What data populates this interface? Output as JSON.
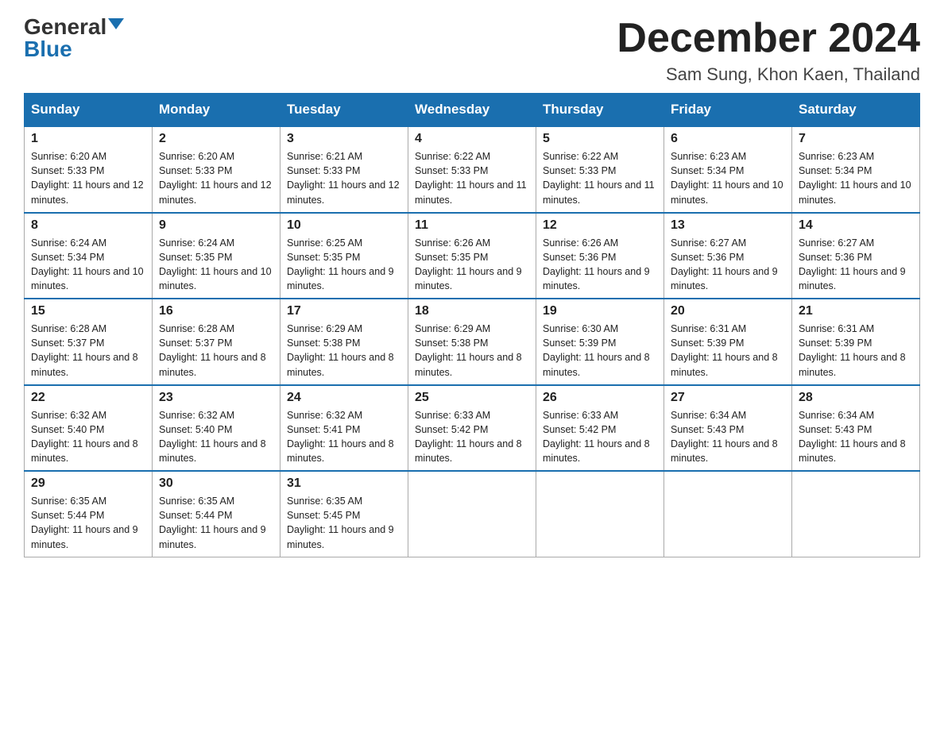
{
  "logo": {
    "general": "General",
    "blue": "Blue"
  },
  "title": "December 2024",
  "subtitle": "Sam Sung, Khon Kaen, Thailand",
  "days": [
    "Sunday",
    "Monday",
    "Tuesday",
    "Wednesday",
    "Thursday",
    "Friday",
    "Saturday"
  ],
  "weeks": [
    [
      {
        "num": "1",
        "sunrise": "6:20 AM",
        "sunset": "5:33 PM",
        "daylight": "11 hours and 12 minutes."
      },
      {
        "num": "2",
        "sunrise": "6:20 AM",
        "sunset": "5:33 PM",
        "daylight": "11 hours and 12 minutes."
      },
      {
        "num": "3",
        "sunrise": "6:21 AM",
        "sunset": "5:33 PM",
        "daylight": "11 hours and 12 minutes."
      },
      {
        "num": "4",
        "sunrise": "6:22 AM",
        "sunset": "5:33 PM",
        "daylight": "11 hours and 11 minutes."
      },
      {
        "num": "5",
        "sunrise": "6:22 AM",
        "sunset": "5:33 PM",
        "daylight": "11 hours and 11 minutes."
      },
      {
        "num": "6",
        "sunrise": "6:23 AM",
        "sunset": "5:34 PM",
        "daylight": "11 hours and 10 minutes."
      },
      {
        "num": "7",
        "sunrise": "6:23 AM",
        "sunset": "5:34 PM",
        "daylight": "11 hours and 10 minutes."
      }
    ],
    [
      {
        "num": "8",
        "sunrise": "6:24 AM",
        "sunset": "5:34 PM",
        "daylight": "11 hours and 10 minutes."
      },
      {
        "num": "9",
        "sunrise": "6:24 AM",
        "sunset": "5:35 PM",
        "daylight": "11 hours and 10 minutes."
      },
      {
        "num": "10",
        "sunrise": "6:25 AM",
        "sunset": "5:35 PM",
        "daylight": "11 hours and 9 minutes."
      },
      {
        "num": "11",
        "sunrise": "6:26 AM",
        "sunset": "5:35 PM",
        "daylight": "11 hours and 9 minutes."
      },
      {
        "num": "12",
        "sunrise": "6:26 AM",
        "sunset": "5:36 PM",
        "daylight": "11 hours and 9 minutes."
      },
      {
        "num": "13",
        "sunrise": "6:27 AM",
        "sunset": "5:36 PM",
        "daylight": "11 hours and 9 minutes."
      },
      {
        "num": "14",
        "sunrise": "6:27 AM",
        "sunset": "5:36 PM",
        "daylight": "11 hours and 9 minutes."
      }
    ],
    [
      {
        "num": "15",
        "sunrise": "6:28 AM",
        "sunset": "5:37 PM",
        "daylight": "11 hours and 8 minutes."
      },
      {
        "num": "16",
        "sunrise": "6:28 AM",
        "sunset": "5:37 PM",
        "daylight": "11 hours and 8 minutes."
      },
      {
        "num": "17",
        "sunrise": "6:29 AM",
        "sunset": "5:38 PM",
        "daylight": "11 hours and 8 minutes."
      },
      {
        "num": "18",
        "sunrise": "6:29 AM",
        "sunset": "5:38 PM",
        "daylight": "11 hours and 8 minutes."
      },
      {
        "num": "19",
        "sunrise": "6:30 AM",
        "sunset": "5:39 PM",
        "daylight": "11 hours and 8 minutes."
      },
      {
        "num": "20",
        "sunrise": "6:31 AM",
        "sunset": "5:39 PM",
        "daylight": "11 hours and 8 minutes."
      },
      {
        "num": "21",
        "sunrise": "6:31 AM",
        "sunset": "5:39 PM",
        "daylight": "11 hours and 8 minutes."
      }
    ],
    [
      {
        "num": "22",
        "sunrise": "6:32 AM",
        "sunset": "5:40 PM",
        "daylight": "11 hours and 8 minutes."
      },
      {
        "num": "23",
        "sunrise": "6:32 AM",
        "sunset": "5:40 PM",
        "daylight": "11 hours and 8 minutes."
      },
      {
        "num": "24",
        "sunrise": "6:32 AM",
        "sunset": "5:41 PM",
        "daylight": "11 hours and 8 minutes."
      },
      {
        "num": "25",
        "sunrise": "6:33 AM",
        "sunset": "5:42 PM",
        "daylight": "11 hours and 8 minutes."
      },
      {
        "num": "26",
        "sunrise": "6:33 AM",
        "sunset": "5:42 PM",
        "daylight": "11 hours and 8 minutes."
      },
      {
        "num": "27",
        "sunrise": "6:34 AM",
        "sunset": "5:43 PM",
        "daylight": "11 hours and 8 minutes."
      },
      {
        "num": "28",
        "sunrise": "6:34 AM",
        "sunset": "5:43 PM",
        "daylight": "11 hours and 8 minutes."
      }
    ],
    [
      {
        "num": "29",
        "sunrise": "6:35 AM",
        "sunset": "5:44 PM",
        "daylight": "11 hours and 9 minutes."
      },
      {
        "num": "30",
        "sunrise": "6:35 AM",
        "sunset": "5:44 PM",
        "daylight": "11 hours and 9 minutes."
      },
      {
        "num": "31",
        "sunrise": "6:35 AM",
        "sunset": "5:45 PM",
        "daylight": "11 hours and 9 minutes."
      },
      null,
      null,
      null,
      null
    ]
  ]
}
